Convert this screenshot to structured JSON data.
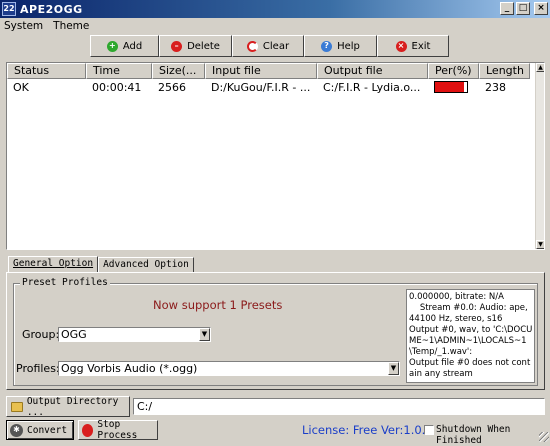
{
  "window": {
    "title": "APE2OGG",
    "icon": "22"
  },
  "menu": [
    "System",
    "Theme"
  ],
  "toolbar": [
    {
      "label": "Add",
      "icon": "add-icon",
      "color": "#2ea82e"
    },
    {
      "label": "Delete",
      "icon": "delete-icon",
      "color": "#d81e1e"
    },
    {
      "label": "Clear",
      "icon": "clear-icon",
      "color": "#d81e1e"
    },
    {
      "label": "Help",
      "icon": "help-icon",
      "color": "#3a7bd5"
    },
    {
      "label": "Exit",
      "icon": "exit-icon",
      "color": "#d81e1e"
    }
  ],
  "table": {
    "columns": [
      "Status",
      "Time",
      "Size(...",
      "Input file",
      "Output file",
      "Per(%)",
      "Length"
    ],
    "rows": [
      {
        "status": "OK",
        "time": "00:00:41",
        "size": "2566",
        "input": "D:/KuGou/F.I.R - ...",
        "output": "C:/F.I.R - Lydia.o...",
        "per": 0.9,
        "length": "238"
      }
    ]
  },
  "tabs": [
    "General Option",
    "Advanced Option"
  ],
  "preset": {
    "group_title": "Preset Profiles",
    "support_text": "Now support 1 Presets",
    "group_label": "Group:",
    "group_value": "OGG",
    "profiles_label": "Profiles:",
    "profiles_value": "Ogg Vorbis Audio (*.ogg)",
    "log": "0.000000, bitrate: N/A\n    Stream #0.0: Audio: ape, 44100 Hz, stereo, s16\nOutput #0, wav, to 'C:\\DOCUME~1\\ADMIN~1\\LOCALS~1\\Temp/_1.wav':\nOutput file #0 does not contain any stream"
  },
  "output_directory": {
    "button_label": "Output Directory ...",
    "value": "C:/"
  },
  "actions": {
    "convert_label": "Convert",
    "stop_label": "Stop Process"
  },
  "license_text": "License: Free Ver:1.0.1",
  "shutdown_label": "Shutdown When Finished",
  "colors": {
    "progress": "#e01010",
    "license": "#1a3ec8",
    "support": "#8b1a1a"
  }
}
